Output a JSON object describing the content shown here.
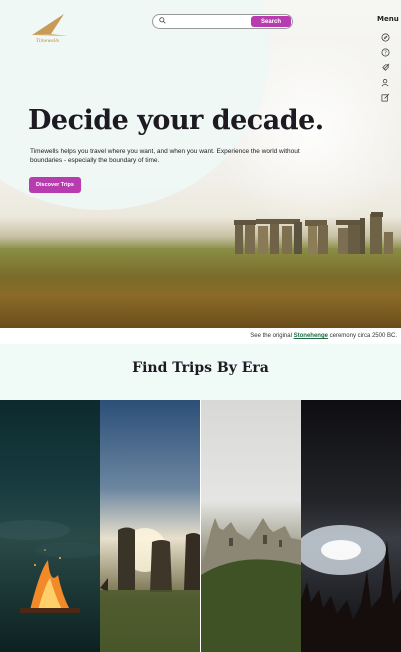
{
  "header": {
    "logo_text": "Timewells",
    "search_placeholder": "",
    "search_button_label": "Search",
    "menu_label": "Menu",
    "menu_icons": [
      "compass-icon",
      "help-icon",
      "rocket-icon",
      "user-icon",
      "edit-icon"
    ]
  },
  "hero": {
    "headline": "Decide your decade.",
    "intro": "Timewells helps you travel where you want, and when you want. Experience the world without boundaries - especially the boundary of time.",
    "cta_label": "Discover Trips",
    "caption_prefix": "See the original",
    "caption_link": "Stonehenge",
    "caption_suffix": "ceremony circa 2500 BC."
  },
  "eras": {
    "title": "Find Trips By Era",
    "cards": [
      "stone-age-fire",
      "easter-island-moai",
      "medieval-castle-ruins",
      "modern-concert"
    ]
  },
  "colors": {
    "accent": "#b83bb0",
    "link": "#1f6b45",
    "mint": "#eef8f4"
  }
}
